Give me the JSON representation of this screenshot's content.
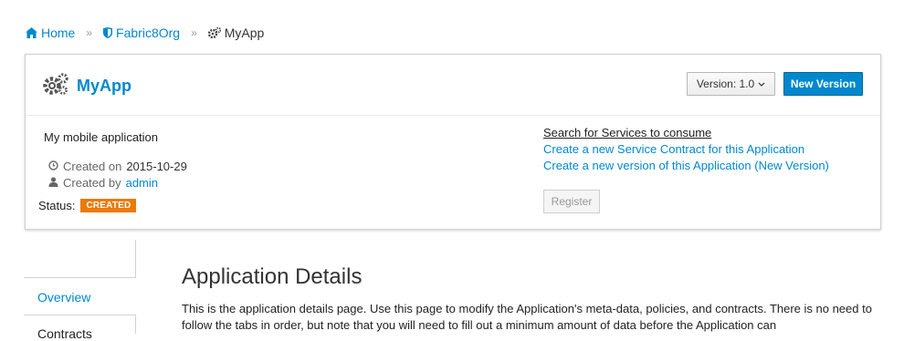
{
  "breadcrumb": {
    "home": "Home",
    "org": "Fabric8Org",
    "app": "MyApp",
    "separator": "»"
  },
  "header": {
    "title": "MyApp",
    "version_label": "Version: 1.0",
    "new_version_label": "New Version"
  },
  "details": {
    "description": "My mobile application",
    "created_on_label": "Created on",
    "created_on_value": "2015-10-29",
    "created_by_label": "Created by",
    "created_by_value": "admin",
    "status_label": "Status:",
    "status_value": "CREATED"
  },
  "actions": {
    "search_services": "Search for Services to consume",
    "create_contract": "Create a new Service Contract for this Application",
    "create_version": "Create a new version of this Application (New Version)",
    "register_label": "Register"
  },
  "sidebar": {
    "tabs": [
      {
        "label": "Overview"
      },
      {
        "label": "Contracts"
      }
    ]
  },
  "main": {
    "title": "Application Details",
    "text": "This is the application details page. Use this page to modify the Application's meta-data, policies, and contracts. There is no need to follow the tabs in order, but note that you will need to fill out a minimum amount of data before the Application can"
  },
  "colors": {
    "accent": "#0088ce",
    "status_created": "#ec7a08"
  },
  "icons": {
    "home": "home-icon",
    "org": "shield-icon",
    "app": "cogs-icon",
    "created_on": "clock-icon",
    "created_by": "user-icon",
    "version_dropdown": "chevron-down-icon"
  }
}
